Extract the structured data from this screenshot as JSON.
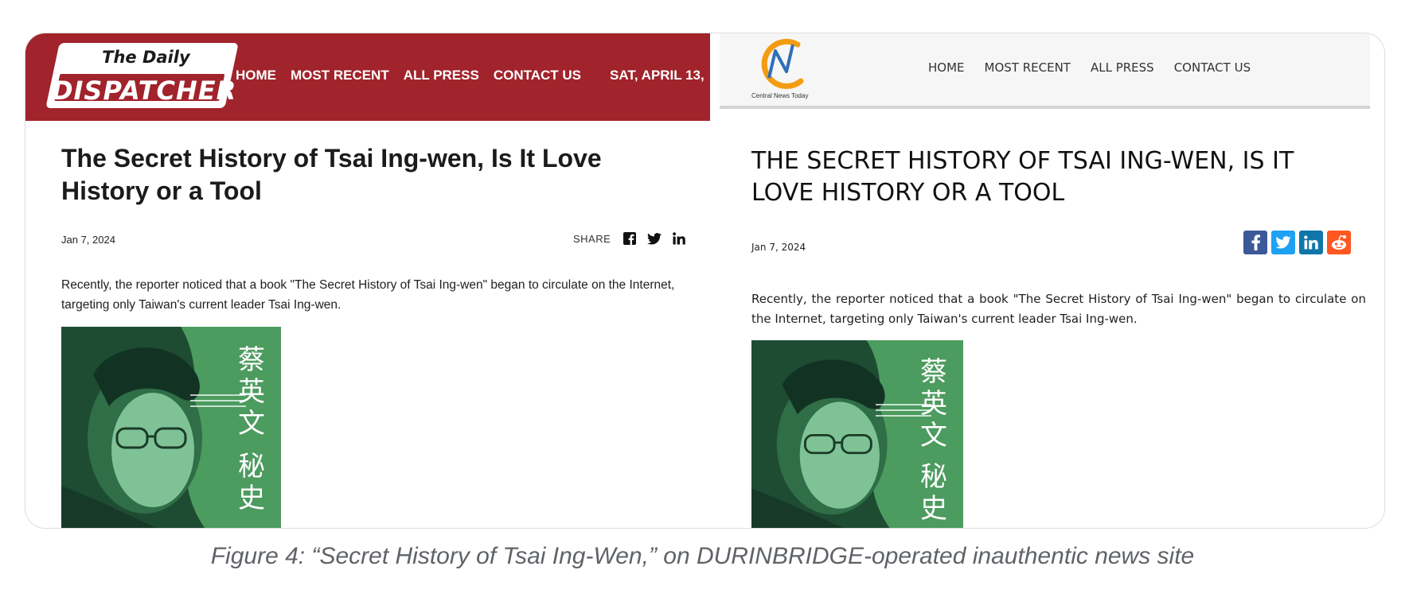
{
  "left_site": {
    "logo_top": "The Daily",
    "logo_main": "DISPATCHER",
    "nav": [
      "HOME",
      "MOST RECENT",
      "ALL PRESS",
      "CONTACT US"
    ],
    "header_date": "SAT, APRIL 13,",
    "title": "The Secret History of Tsai Ing-wen, Is It Love History or a Tool",
    "date": "Jan 7, 2024",
    "share_label": "SHARE",
    "share_icons": [
      "facebook-icon",
      "twitter-icon",
      "linkedin-icon"
    ],
    "body": "Recently, the reporter noticed that a book \"The Secret History of Tsai Ing-wen\" began to circulate on the Internet, targeting only Taiwan's current leader Tsai Ing-wen.",
    "cover_chars": [
      "蔡",
      "英",
      "文",
      "秘",
      "史"
    ],
    "header_color": "#a1232b"
  },
  "right_site": {
    "logo_text": "Central News Today",
    "nav": [
      "HOME",
      "MOST RECENT",
      "ALL PRESS",
      "CONTACT US"
    ],
    "title": "THE SECRET HISTORY OF TSAI ING-WEN, IS IT LOVE HISTORY OR A TOOL",
    "date": "Jan 7, 2024",
    "share_icons": [
      "facebook-icon",
      "twitter-icon",
      "linkedin-icon",
      "reddit-icon"
    ],
    "share_colors": [
      "#3b5998",
      "#1da1f2",
      "#0e76a8",
      "#ff5722"
    ],
    "body": "Recently, the reporter noticed that a book \"The Secret History of Tsai Ing-wen\" began to circulate on the Internet, targeting only Taiwan's current leader Tsai Ing-wen.",
    "cover_chars": [
      "蔡",
      "英",
      "文",
      "秘",
      "史"
    ]
  },
  "caption": "Figure 4: “Secret History of Tsai Ing-Wen,” on DURINBRIDGE-operated inauthentic news site"
}
